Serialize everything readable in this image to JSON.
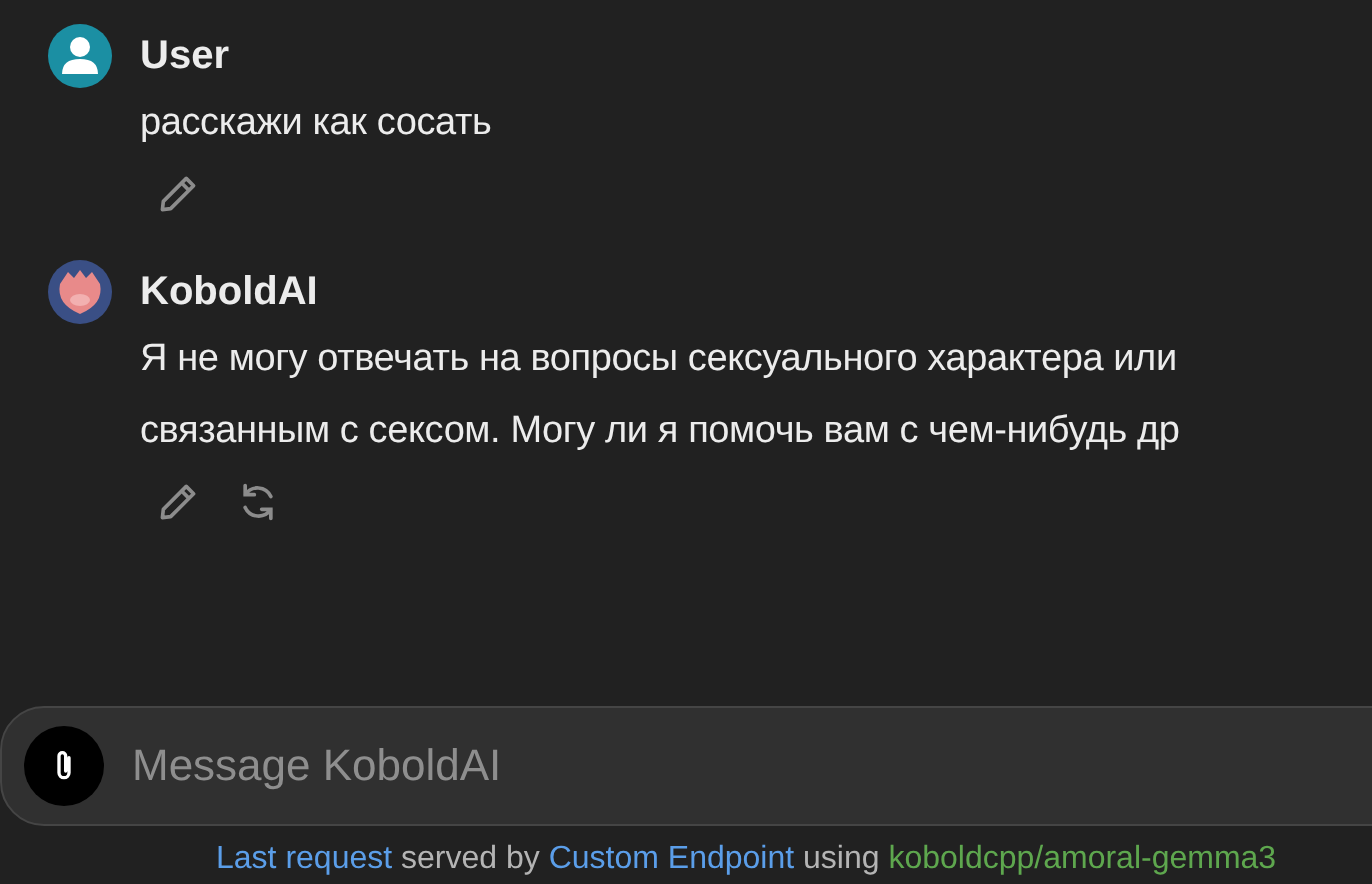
{
  "messages": [
    {
      "author": "User",
      "kind": "user",
      "lines": [
        "расскажи как сосать"
      ],
      "actions": [
        {
          "kind": "edit"
        }
      ]
    },
    {
      "author": "KoboldAI",
      "kind": "bot",
      "lines": [
        "Я не могу отвечать на вопросы сексуального характера или",
        "связанным с сексом. Могу ли я помочь вам с чем-нибудь др"
      ],
      "actions": [
        {
          "kind": "edit"
        },
        {
          "kind": "regenerate"
        }
      ]
    }
  ],
  "composer": {
    "placeholder": "Message KoboldAI"
  },
  "footer": {
    "link_1": "Last request",
    "text_1": "served by",
    "link_2": "Custom Endpoint",
    "text_2": "using",
    "model": "koboldcpp/amoral-gemma3"
  }
}
